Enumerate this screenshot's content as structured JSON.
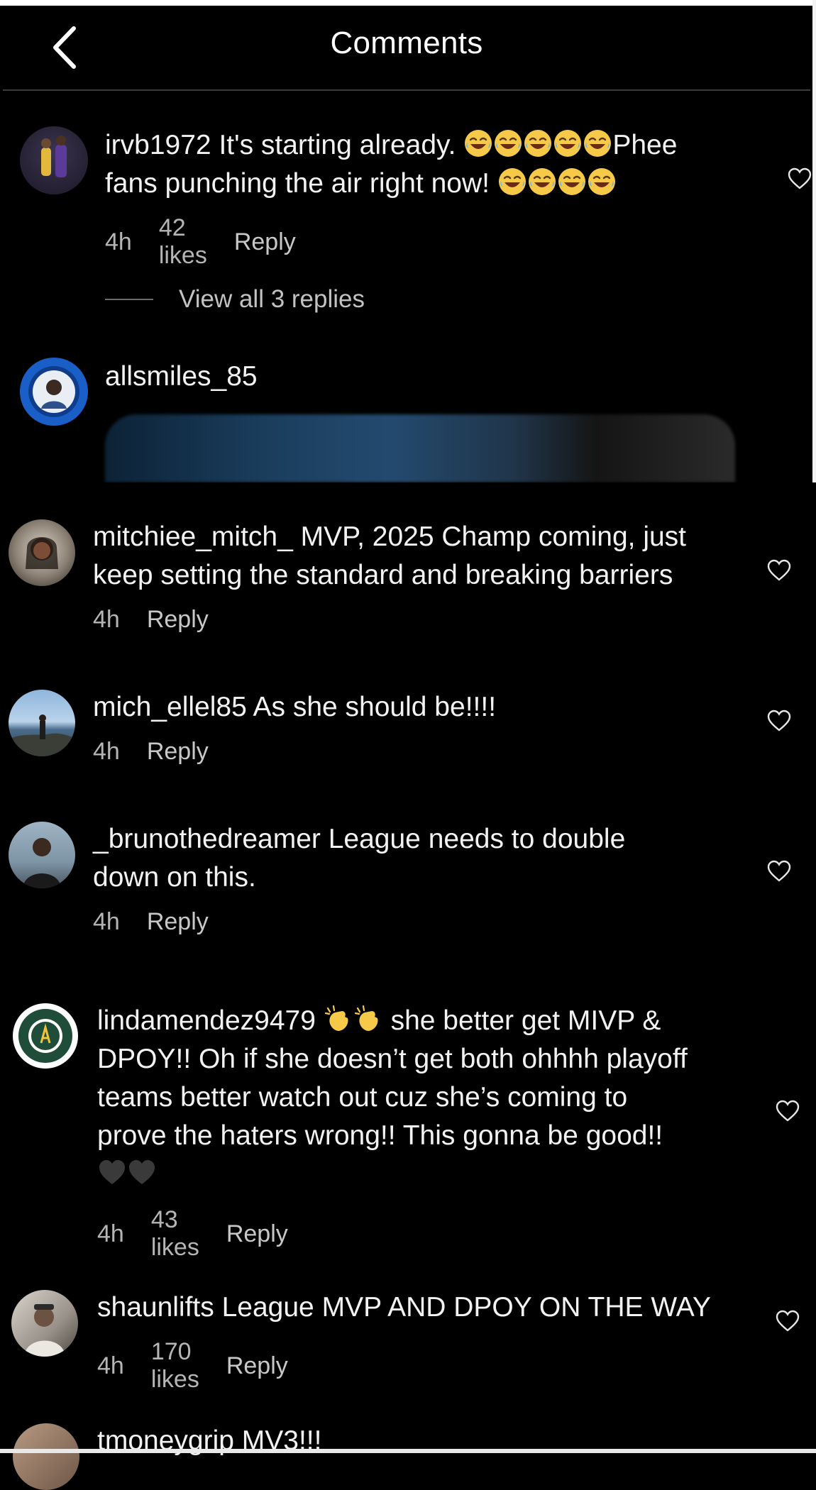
{
  "header": {
    "title": "Comments",
    "back_icon": "chevron-left-icon"
  },
  "comments": [
    {
      "username": "irvb1972",
      "text_line1": "It's starting already.",
      "text_line1_tail": "Phee",
      "text_line2": "fans punching the air right now!",
      "emoji_count_line1": 5,
      "emoji_count_line2": 4,
      "emoji": "face-with-tears-of-joy",
      "time": "4h",
      "likes": "42 likes",
      "reply": "Reply"
    },
    {
      "username": "mitchiee_mitch_",
      "text_line1": "MVP, 2025 Champ coming, just",
      "text_line2": "keep setting the standard and breaking barriers",
      "time": "4h",
      "reply": "Reply"
    },
    {
      "username": "mich_ellel85",
      "text_line1": "As she should be!!!!",
      "time": "4h",
      "reply": "Reply"
    },
    {
      "username": "_brunothedreamer",
      "text_line1": "League needs to double",
      "text_line2": "down on this.",
      "time": "4h",
      "reply": "Reply"
    },
    {
      "username": "lindamendez9479",
      "text_line1": "she better get MIVP &",
      "text_line2": "DPOY!! Oh if she doesn’t get both ohhhh playoff",
      "text_line3": "teams better watch out cuz she’s coming to",
      "text_line4": "prove the haters wrong!! This gonna be good!!",
      "emoji_line1": "clapping-hands",
      "emoji_line5": "black-heart",
      "time": "4h",
      "likes": "43 likes",
      "reply": "Reply"
    },
    {
      "username": "shaunlifts",
      "text_line1": "League MVP AND DPOY ON THE WAY",
      "time": "4h",
      "likes": "170 likes",
      "reply": "Reply"
    },
    {
      "username": "tmoneygrip",
      "text_line1": "MV3!!!"
    }
  ],
  "replies": {
    "label": "View all 3 replies"
  },
  "media_comment": {
    "username": "allsmiles_85"
  },
  "colors": {
    "background": "#000000",
    "text": "#f2f2f2",
    "meta": "#b5b5b5",
    "emoji": "#f7c948"
  }
}
